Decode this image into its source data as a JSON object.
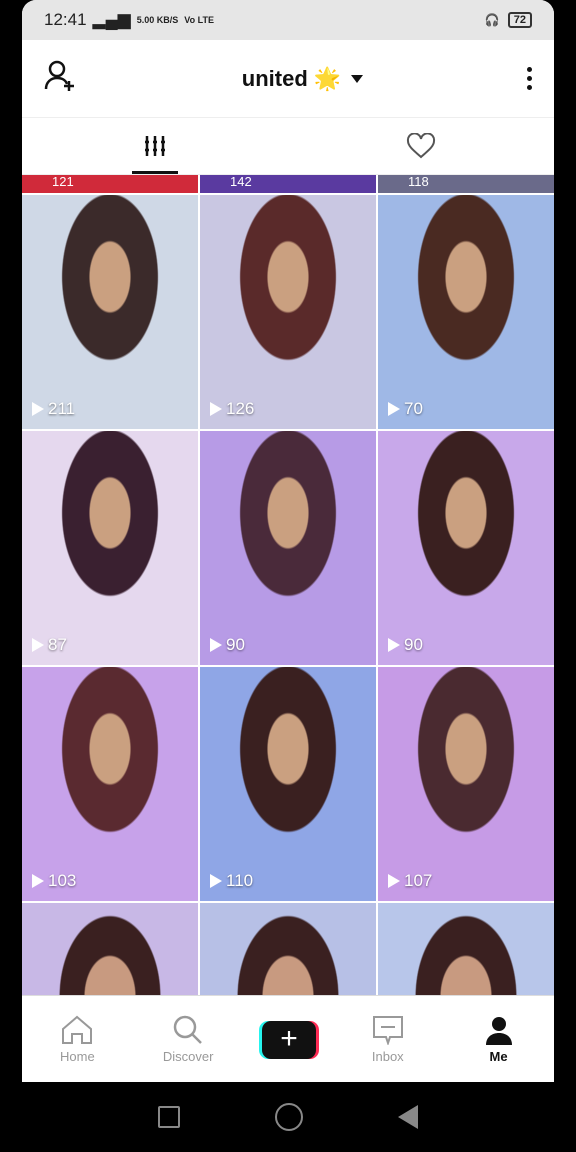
{
  "status": {
    "time": "12:41",
    "net_speed": "5.00 KB/S",
    "network": "Vo LTE",
    "battery": "72"
  },
  "header": {
    "title": "united",
    "emoji": "🌟"
  },
  "icons": {
    "add_user": "add-user-icon",
    "more": "more-icon",
    "grid": "grid-icon",
    "heart": "heart-icon"
  },
  "partial_top": [
    "121",
    "142",
    "118"
  ],
  "videos": [
    {
      "views": "211",
      "colors": [
        "#cfd8e6",
        "#3b2a2a"
      ]
    },
    {
      "views": "126",
      "colors": [
        "#c9c7e2",
        "#5a2a2a"
      ]
    },
    {
      "views": "70",
      "colors": [
        "#9fb8e6",
        "#4a2a22"
      ]
    },
    {
      "views": "87",
      "colors": [
        "#e5d8ee",
        "#3a2030"
      ]
    },
    {
      "views": "90",
      "colors": [
        "#b79be6",
        "#4a2a3a"
      ]
    },
    {
      "views": "90",
      "colors": [
        "#c8a8ea",
        "#3a2020"
      ]
    },
    {
      "views": "103",
      "colors": [
        "#c7a2ea",
        "#5a2a30"
      ]
    },
    {
      "views": "110",
      "colors": [
        "#8fa6e6",
        "#3a2020"
      ]
    },
    {
      "views": "107",
      "colors": [
        "#c69be6",
        "#4a2a30"
      ]
    }
  ],
  "nav": {
    "home": "Home",
    "discover": "Discover",
    "add": "+",
    "inbox": "Inbox",
    "me": "Me"
  }
}
